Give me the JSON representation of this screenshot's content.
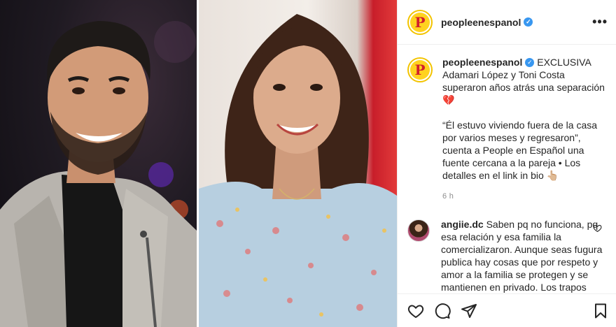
{
  "post": {
    "username": "peopleenespanol",
    "avatar_letter": "P",
    "caption": {
      "text": "EXCLUSIVA Adamari López y Toni Costa superaron años atrás una separación 💔\n\n“Él estuvo viviendo fuera de la casa por varios meses y regresaron”, cuenta a People en Español una fuente cercana a la pareja • Los detalles en el link in bio 👆🏼"
    },
    "time": "6 h",
    "comments": [
      {
        "username": "angiie.dc",
        "text": "Saben pq no funciona, pq esa relación y esa familia la comercializaron. Aunque seas fugura publica hay cosas que por respeto y amor a la familia se protegen y se mantienen en privado. Los trapos sucios se lavan en la casa no en exclusiva en Un"
      }
    ]
  },
  "icons": {
    "verified": "verified-badge-icon",
    "more": "more-options-icon",
    "like": "heart-icon",
    "comment": "comment-icon",
    "share": "share-icon",
    "save": "bookmark-icon",
    "comment_like": "small-heart-icon"
  },
  "colors": {
    "brand_yellow": "#ffd21f",
    "brand_red": "#d21f2c",
    "verified_blue": "#3897f0",
    "meta_gray": "#8e8e8e"
  }
}
